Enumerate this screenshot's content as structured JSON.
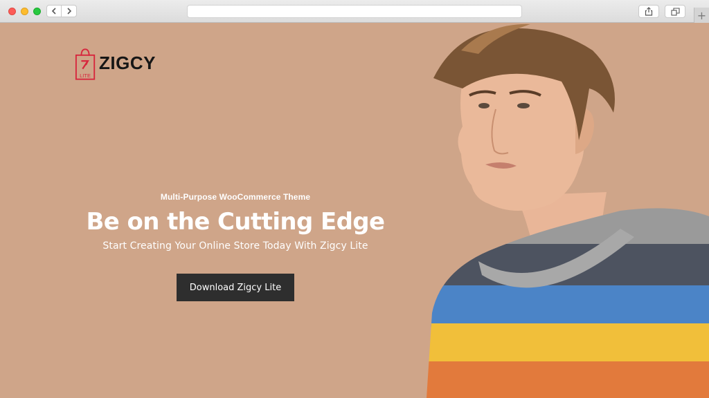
{
  "browser": {
    "url": "",
    "icons": {
      "back": "chevron-left-icon",
      "forward": "chevron-right-icon",
      "share": "share-icon",
      "tabs": "tab-overview-icon",
      "new_tab": "plus-icon"
    },
    "new_tab_label": "+"
  },
  "brand": {
    "name": "ZIGCY",
    "sub": "LITE",
    "accent": "#d7263d",
    "text_color": "#161616"
  },
  "hero": {
    "eyebrow": "Multi-Purpose WooCommerce Theme",
    "headline": "Be on the Cutting Edge",
    "subheadline": "Start Creating Your Online Store Today With Zigcy Lite",
    "cta_label": "Download Zigcy Lite",
    "background": "#cfa589",
    "cta_color": "#2e2e2e"
  }
}
